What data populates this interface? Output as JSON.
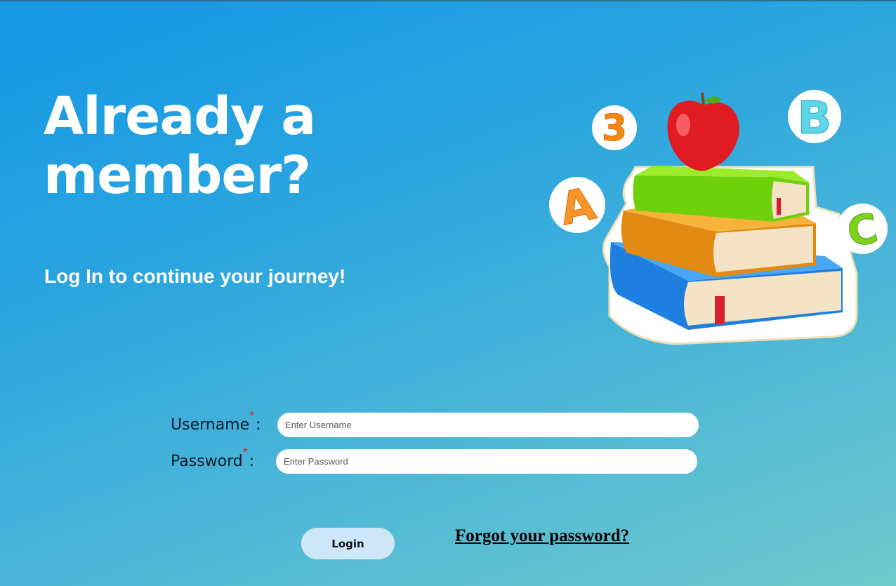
{
  "hero": {
    "title_line1": "Already a",
    "title_line2": "member?",
    "subtitle": "Log In to continue your journey!"
  },
  "illustration": {
    "letters": [
      "3",
      "B",
      "A",
      "C"
    ]
  },
  "form": {
    "username_label": "Username",
    "username_placeholder": "Enter Username",
    "password_label": "Password",
    "password_placeholder": "Enter Password",
    "required_marker": "*",
    "colon": ":"
  },
  "actions": {
    "login_label": "Login",
    "forgot_label": "Forgot your password?"
  },
  "colors": {
    "background_top": "#1597e5",
    "background_bottom": "#6fcacb",
    "login_button": "#cde7f8",
    "required": "#d9262c"
  }
}
